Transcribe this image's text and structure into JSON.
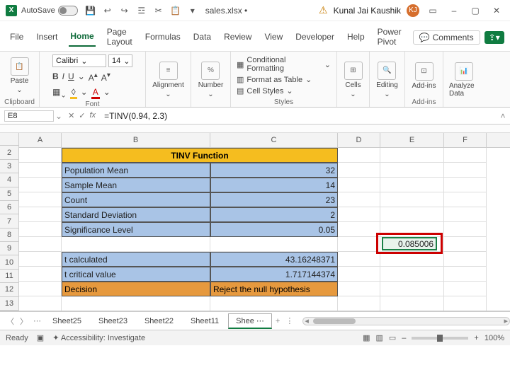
{
  "title": {
    "autosave": "AutoSave",
    "filename": "sales.xlsx •",
    "user": "Kunal Jai Kaushik",
    "initials": "KJ"
  },
  "menutabs": {
    "file": "File",
    "insert": "Insert",
    "home": "Home",
    "pagelayout": "Page Layout",
    "formulas": "Formulas",
    "data": "Data",
    "review": "Review",
    "view": "View",
    "developer": "Developer",
    "help": "Help",
    "powerpivot": "Power Pivot",
    "comments": "Comments"
  },
  "ribbon": {
    "clipboard": "Clipboard",
    "paste": "Paste",
    "font": "Font",
    "fontname": "Calibri",
    "fontsize": "14",
    "alignment": "Alignment",
    "number": "Number",
    "styles": "Styles",
    "condfmt": "Conditional Formatting",
    "fmttable": "Format as Table",
    "cellstyles": "Cell Styles",
    "cells": "Cells",
    "editing": "Editing",
    "addins": "Add-ins",
    "addins_label": "Add-ins",
    "analyze": "Analyze Data"
  },
  "namebox": {
    "ref": "E8",
    "formula": "=TINV(0.94, 2.3)"
  },
  "cols": {
    "A": "A",
    "B": "B",
    "C": "C",
    "D": "D",
    "E": "E",
    "F": "F"
  },
  "rows": [
    "2",
    "3",
    "4",
    "5",
    "6",
    "7",
    "8",
    "9",
    "10",
    "11",
    "12",
    "13"
  ],
  "data": {
    "title": "TINV Function",
    "r3b": "Population Mean",
    "r3c": "32",
    "r4b": "Sample Mean",
    "r4c": "14",
    "r5b": "Count",
    "r5c": "23",
    "r6b": "Standard Deviation",
    "r6c": "2",
    "r7b": "Significance Level",
    "r7c": "0.05",
    "e8": "0.085006",
    "r9b": "t calculated",
    "r9c": "43.16248371",
    "r10b": "t critical value",
    "r10c": "1.717144374",
    "r11b": "Decision",
    "r11c": "Reject the null hypothesis"
  },
  "sheets": {
    "s25": "Sheet25",
    "s23": "Sheet23",
    "s22": "Sheet22",
    "s11": "Sheet11",
    "active": "Shee"
  },
  "status": {
    "ready": "Ready",
    "access": "Accessibility: Investigate",
    "zoom": "100%"
  },
  "icons": {
    "percent": "%",
    "bold": "B",
    "italic": "I",
    "underline": "U",
    "chev": "⌄",
    "dash": "–",
    "close": "✕",
    "box": "▢",
    "plus": "+",
    "dots": "⋮",
    "ellipsis": "⋯",
    "search": "🔍",
    "save": "💾",
    "undo": "↩",
    "redo": "↪",
    "grid_icon": "▦"
  }
}
